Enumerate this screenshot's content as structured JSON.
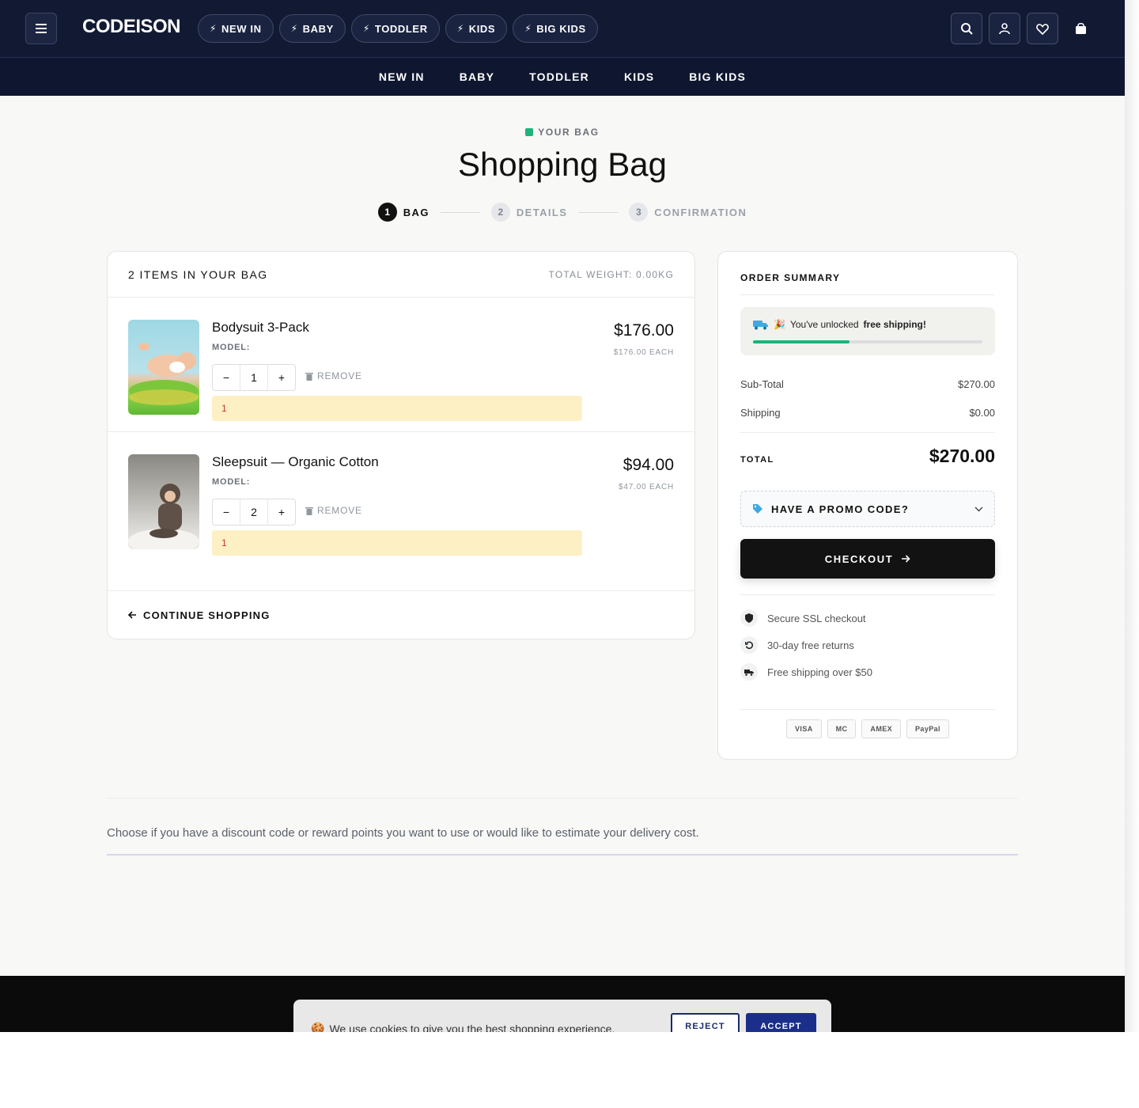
{
  "brand": "CODEISON",
  "header": {
    "pills": [
      "NEW IN",
      "BABY",
      "TODDLER",
      "KIDS",
      "BIG KIDS"
    ],
    "icons": [
      "search-icon",
      "account-icon",
      "heart-icon",
      "bag-icon"
    ]
  },
  "nav": [
    "NEW IN",
    "BABY",
    "TODDLER",
    "KIDS",
    "BIG KIDS"
  ],
  "page": {
    "eyebrow": "YOUR BAG",
    "title": "Shopping Bag"
  },
  "steps": [
    {
      "num": "1",
      "label": "BAG",
      "active": true
    },
    {
      "num": "2",
      "label": "DETAILS",
      "active": false
    },
    {
      "num": "3",
      "label": "CONFIRMATION",
      "active": false
    }
  ],
  "cart": {
    "count_label": "2 ITEMS IN YOUR BAG",
    "weight_label": "TOTAL WEIGHT: 0.00KG",
    "remove_label": "REMOVE",
    "model_label": "MODEL:",
    "items": [
      {
        "name": "Bodysuit 3-Pack",
        "qty": "1",
        "price": "$176.00",
        "each": "$176.00 EACH",
        "note": "1"
      },
      {
        "name": "Sleepsuit — Organic Cotton",
        "qty": "2",
        "price": "$94.00",
        "each": "$47.00 EACH",
        "note": "1"
      }
    ],
    "continue_label": "CONTINUE SHOPPING"
  },
  "summary": {
    "title": "ORDER SUMMARY",
    "shipping_msg": "You've unlocked",
    "shipping_bold": "free shipping!",
    "shipping_progress": 0.42,
    "subtotal_label": "Sub-Total",
    "subtotal": "$270.00",
    "shipping_label": "Shipping",
    "shipping": "$0.00",
    "total_label": "TOTAL",
    "total": "$270.00",
    "promo_label": "HAVE A PROMO CODE?",
    "checkout_label": "CHECKOUT",
    "trust": [
      {
        "icon": "shield-icon",
        "text": "Secure SSL checkout"
      },
      {
        "icon": "returns-icon",
        "text": "30-day free returns"
      },
      {
        "icon": "truck-icon",
        "text": "Free shipping over $50"
      }
    ],
    "payments": [
      "VISA",
      "MC",
      "AMEX",
      "PayPal"
    ]
  },
  "discount_text": "Choose if you have a discount code or reward points you want to use or would like to estimate your delivery cost.",
  "cookie": {
    "text": "We use cookies to give you the best shopping experience.",
    "reject": "REJECT",
    "accept": "ACCEPT"
  },
  "colors": {
    "header_bg": "#121a33",
    "accent_green": "#1db37a",
    "checkout_bg": "#121212",
    "accept_bg": "#1b2f8a"
  }
}
